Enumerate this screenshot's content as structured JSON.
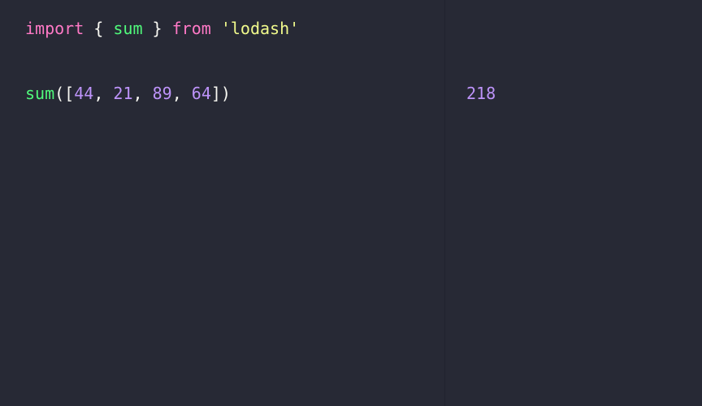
{
  "theme": {
    "background": "#272935",
    "divider": "#21232e",
    "keyword": "#ff79c6",
    "function": "#50fa7b",
    "string": "#f1fa8c",
    "number": "#bd93f9",
    "punctuation": "#f8f8f2",
    "result": "#bd93f9"
  },
  "editor": {
    "line1": {
      "keyword_import": "import",
      "brace_open": " { ",
      "imported_name": "sum",
      "brace_close": " } ",
      "keyword_from": "from",
      "space": " ",
      "module_string": "'lodash'"
    },
    "line2": {
      "function_name": "sum",
      "open": "([",
      "num1": "44",
      "sep1": ", ",
      "num2": "21",
      "sep2": ", ",
      "num3": "89",
      "sep3": ", ",
      "num4": "64",
      "close": "])"
    }
  },
  "results": {
    "line2_value": "218"
  }
}
